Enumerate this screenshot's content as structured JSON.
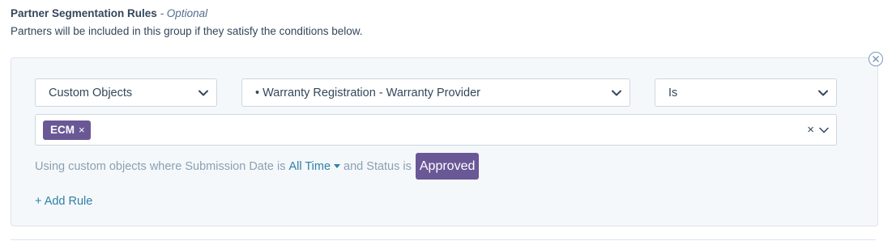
{
  "section": {
    "title": "Partner Segmentation Rules",
    "optional_label": "- Optional",
    "description": "Partners will be included in this group if they satisfy the conditions below."
  },
  "rule": {
    "close_icon": "close-circle-icon",
    "source_select": {
      "value": "Custom Objects"
    },
    "property_select": {
      "value": "• Warranty Registration - Warranty Provider"
    },
    "operator_select": {
      "value": "Is"
    },
    "values": {
      "tags": [
        {
          "label": "ECM",
          "remove": "×"
        }
      ],
      "clear": "×"
    },
    "description": {
      "prefix": "Using custom objects where Submission Date is",
      "time_link": "All Time",
      "middle": "and Status is",
      "status": "Approved"
    }
  },
  "add_rule": "+ Add Rule",
  "colors": {
    "accent": "#6a5896",
    "link": "#2f7fa8",
    "card_bg": "#f5f8fa",
    "border": "#cbd6e2"
  }
}
